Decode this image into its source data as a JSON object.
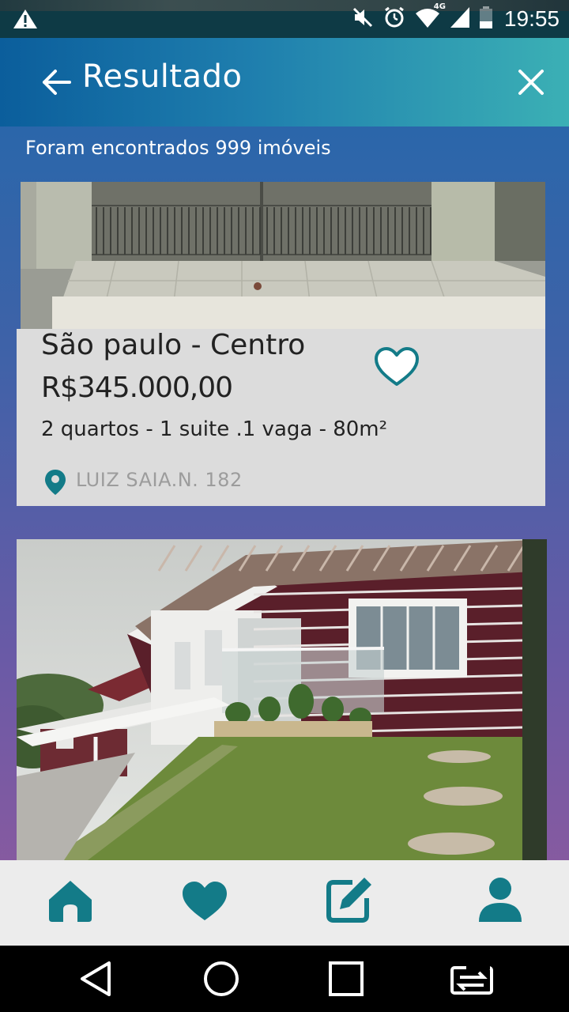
{
  "status_bar": {
    "time": "19:55",
    "network_label": "4G",
    "icons": [
      "warning-icon",
      "mute-icon",
      "alarm-icon",
      "wifi-icon",
      "signal-icon",
      "battery-icon"
    ]
  },
  "header": {
    "title": "Resultado",
    "back_icon": "arrow-left-icon",
    "close_icon": "close-icon"
  },
  "results": {
    "count_text": "Foram encontrados 999 imóveis"
  },
  "listings": [
    {
      "city": "São paulo - Centro",
      "price": "R$345.000,00",
      "features": "2 quartos - 1 suite .1 vaga - 80m²",
      "address": "LUIZ SAIA.N. 182",
      "favorite_icon": "heart-outline-icon"
    },
    {
      "photo": "house-photo"
    }
  ],
  "bottom_nav": {
    "items": [
      "home-icon",
      "heart-icon",
      "edit-icon",
      "user-icon"
    ]
  },
  "system_nav": {
    "items": [
      "back-triangle-icon",
      "home-circle-icon",
      "recents-square-icon",
      "switch-icon"
    ]
  },
  "colors": {
    "accent": "#137b88",
    "header_start": "#0b5e9c",
    "header_end": "#3bb0b5",
    "card_bg": "#dcdcdc"
  }
}
